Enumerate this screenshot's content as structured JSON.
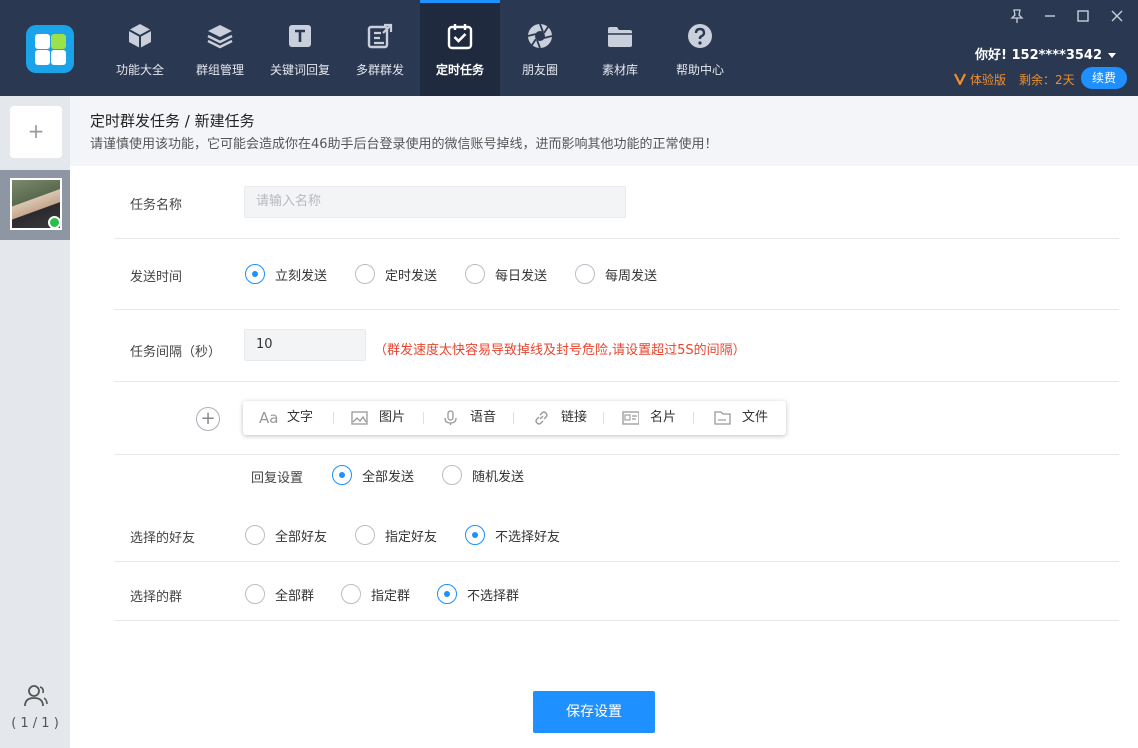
{
  "nav": {
    "items": [
      {
        "label": "功能大全",
        "icon": "cube-icon"
      },
      {
        "label": "群组管理",
        "icon": "layers-icon"
      },
      {
        "label": "关键词回复",
        "icon": "text-t-icon"
      },
      {
        "label": "多群群发",
        "icon": "edit-share-icon"
      },
      {
        "label": "定时任务",
        "icon": "calendar-check-icon",
        "active": true
      },
      {
        "label": "朋友圈",
        "icon": "aperture-icon"
      },
      {
        "label": "素材库",
        "icon": "folder-icon"
      },
      {
        "label": "帮助中心",
        "icon": "help-circle-icon"
      }
    ]
  },
  "account": {
    "greeting": "你好! 152****3542",
    "trial": "体验版",
    "remaining": "剩余：2天",
    "renew": "续费"
  },
  "sidebar": {
    "add": "+",
    "count": "( 1 / 1 )"
  },
  "header": {
    "breadcrumb": "定时群发任务 / 新建任务",
    "warning": "请谨慎使用该功能，它可能会造成你在46助手后台登录使用的微信账号掉线，进而影响其他功能的正常使用！"
  },
  "form": {
    "task_name": {
      "label": "任务名称",
      "placeholder": "请输入名称"
    },
    "send_time": {
      "label": "发送时间",
      "options": [
        "立刻发送",
        "定时发送",
        "每日发送",
        "每周发送"
      ],
      "selected": "立刻发送"
    },
    "interval": {
      "label": "任务间隔（秒）",
      "value": "10",
      "hint": "（群发速度太快容易导致掉线及封号危险,请设置超过5S的间隔）"
    },
    "content_tools": [
      "文字",
      "图片",
      "语音",
      "链接",
      "名片",
      "文件"
    ],
    "reply": {
      "label": "回复设置",
      "options": [
        "全部发送",
        "随机发送"
      ],
      "selected": "全部发送"
    },
    "friends": {
      "label": "选择的好友",
      "options": [
        "全部好友",
        "指定好友",
        "不选择好友"
      ],
      "selected": "不选择好友"
    },
    "groups": {
      "label": "选择的群",
      "options": [
        "全部群",
        "指定群",
        "不选择群"
      ],
      "selected": "不选择群"
    },
    "save": "保存设置"
  },
  "colors": {
    "primary": "#1e90ff",
    "topbar": "#2b3852",
    "warning": "#e8452f",
    "trial": "#f08f2a"
  }
}
